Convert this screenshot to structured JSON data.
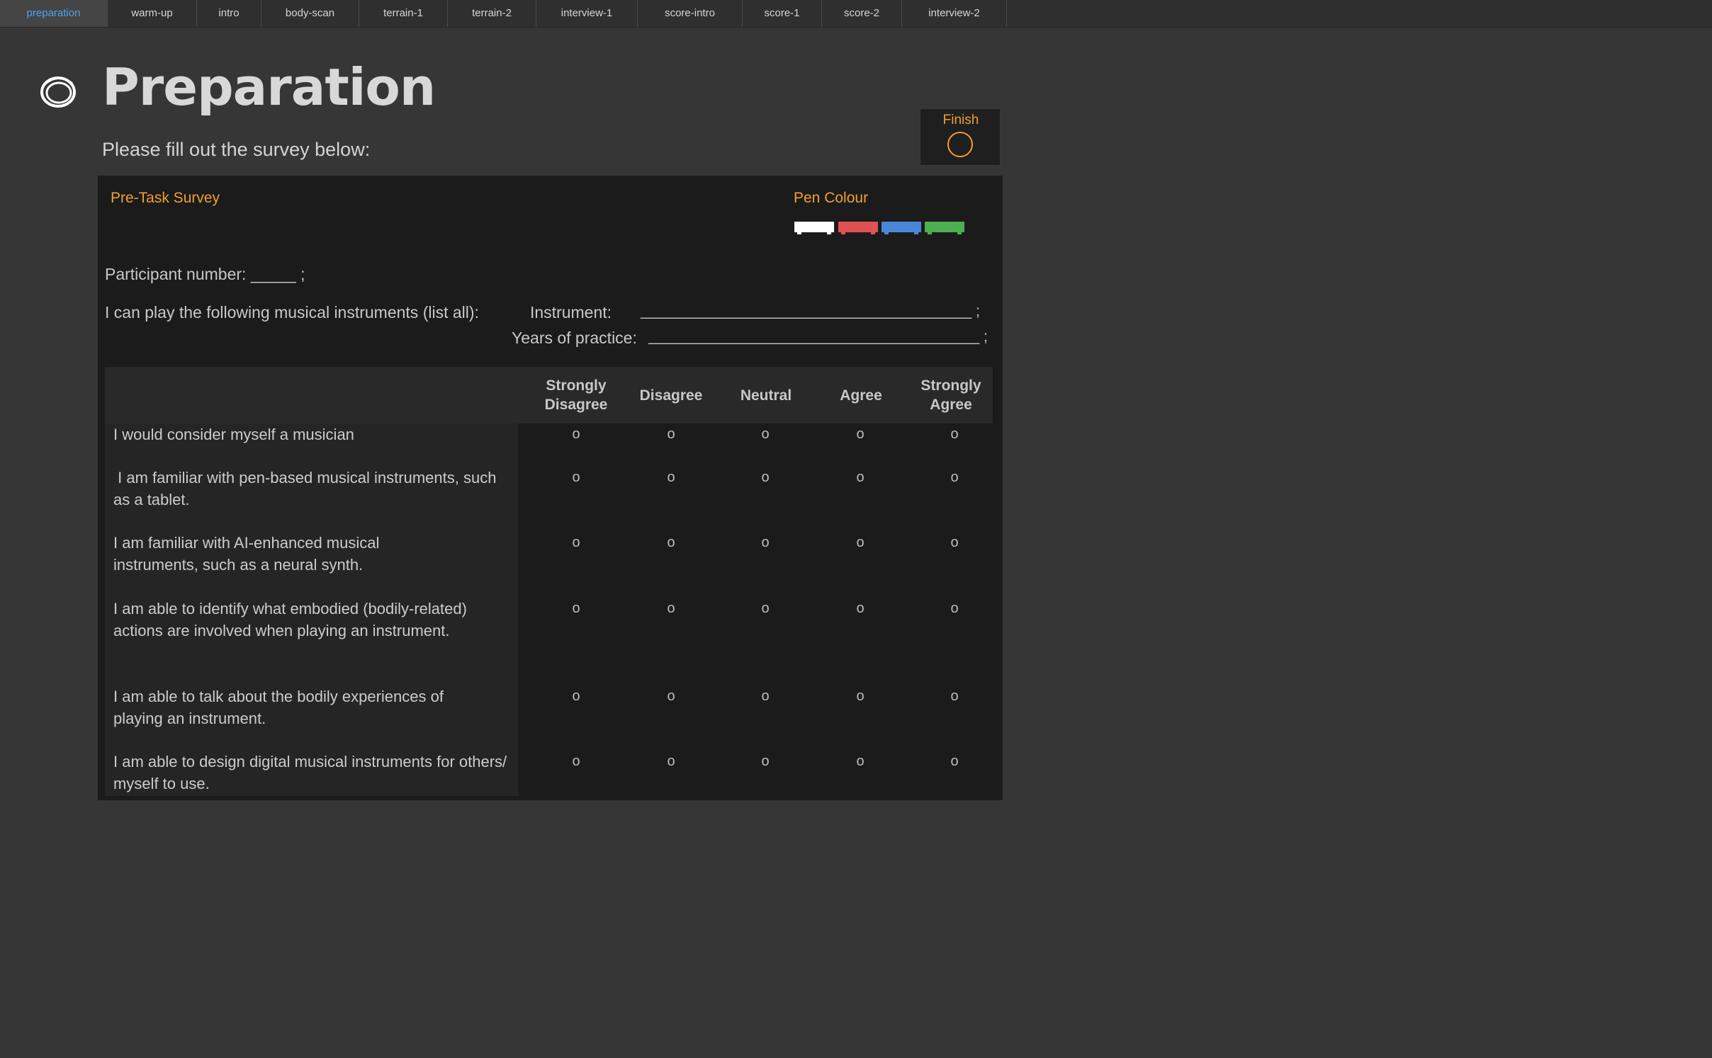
{
  "tabs": [
    "preparation",
    "warm-up",
    "intro",
    "body-scan",
    "terrain-1",
    "terrain-2",
    "interview-1",
    "score-intro",
    "score-1",
    "score-2",
    "interview-2"
  ],
  "active_tab": "preparation",
  "page": {
    "title": "Preparation",
    "subtitle": "Please fill out the survey below:"
  },
  "finish": {
    "label": "Finish"
  },
  "survey": {
    "title": "Pre-Task Survey",
    "pen_colour_label": "Pen Colour",
    "pen_colours": [
      "#ffffff",
      "#e05252",
      "#4a86d8",
      "#4caf50"
    ],
    "participant_line": "Participant number: _____ ;",
    "instruments_prompt": "I can play the following musical instruments (list all):",
    "instrument_label": "Instrument:",
    "instrument_blank": "________________________________________ ;",
    "years_label": "Years of practice:",
    "years_blank": "________________________________________ ;",
    "scale": [
      "Strongly Disagree",
      "Disagree",
      "Neutral",
      "Agree",
      "Strongly Agree"
    ],
    "radio_symbol": "o",
    "questions": [
      "I would consider myself a musician",
      " I am familiar with pen-based musical instruments, such as a tablet.",
      "I am familiar with AI-enhanced musical instruments, such as a neural synth.",
      "I am able to identify what embodied (bodily-related) actions are involved when playing an instrument.",
      "I am able to talk about the bodily experiences of playing an instrument.",
      "I am able to design digital musical instruments for others/ myself to use."
    ]
  },
  "colors": {
    "accent_orange": "#f0a030",
    "active_tab_blue": "#4da3f0",
    "background": "#363636",
    "panel": "#1b1b1b"
  }
}
